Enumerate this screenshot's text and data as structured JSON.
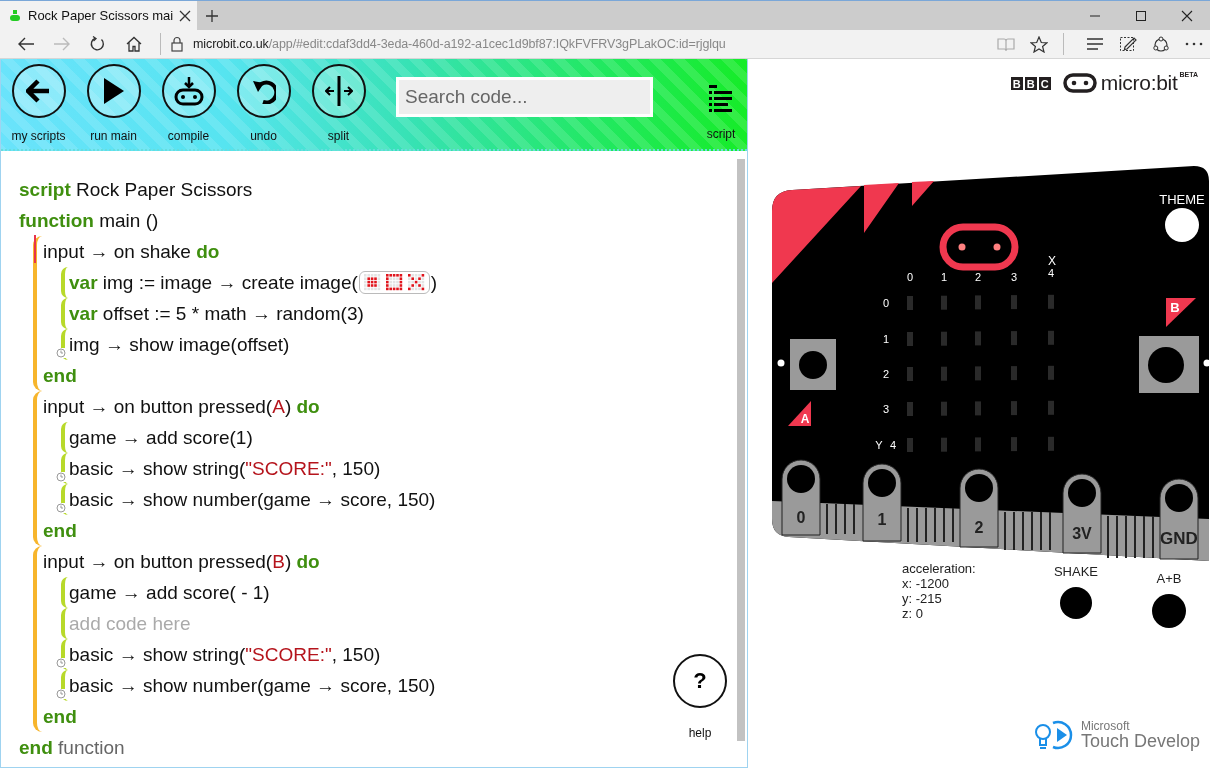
{
  "browser": {
    "tab": {
      "title": "Rock Paper Scissors mai",
      "selected": true
    },
    "back": {
      "disabled": false
    },
    "forward": {
      "disabled": true
    },
    "address": {
      "host": "microbit.co.uk",
      "path": "/app/#edit:cdaf3dd4-3eda-460d-a192-a1cec1d9bf87:IQkFVFRV3gPLakOC:id=rjglqu"
    }
  },
  "toolbar": {
    "buttons": [
      {
        "kind": "back",
        "label": "my scripts"
      },
      {
        "kind": "run",
        "label": "run main"
      },
      {
        "kind": "compile",
        "label": "compile"
      },
      {
        "kind": "undo",
        "label": "undo"
      },
      {
        "kind": "split",
        "label": "split"
      }
    ],
    "search": {
      "placeholder": "Search code..."
    },
    "script_button": {
      "label": "script"
    }
  },
  "code": {
    "title": [
      {
        "kind": "keyword",
        "text": "script"
      },
      {
        "kind": "plain",
        "text": " Rock Paper Scissors"
      }
    ],
    "function": [
      {
        "kind": "keyword",
        "text": "function"
      },
      {
        "kind": "plain",
        "text": " main ()"
      }
    ],
    "blocks": [
      {
        "selected": true,
        "head": [
          {
            "kind": "plain",
            "text": "input → on shake "
          },
          {
            "kind": "keyword",
            "text": "do"
          }
        ],
        "statements": [
          {
            "timer": false,
            "segments": [
              {
                "kind": "keyword",
                "text": "var"
              },
              {
                "kind": "plain",
                "text": " img := image → create image("
              },
              {
                "kind": "image"
              },
              {
                "kind": "plain",
                "text": ")"
              }
            ]
          },
          {
            "timer": false,
            "segments": [
              {
                "kind": "keyword",
                "text": "var"
              },
              {
                "kind": "plain",
                "text": " offset := 5 * math → random(3)"
              }
            ]
          },
          {
            "timer": true,
            "segments": [
              {
                "kind": "plain",
                "text": "img → show image(offset)"
              }
            ]
          }
        ],
        "end": "end"
      },
      {
        "selected": false,
        "head": [
          {
            "kind": "plain",
            "text": "input → on button pressed("
          },
          {
            "kind": "literal",
            "text": "A"
          },
          {
            "kind": "plain",
            "text": ") "
          },
          {
            "kind": "keyword",
            "text": "do"
          }
        ],
        "statements": [
          {
            "timer": false,
            "segments": [
              {
                "kind": "plain",
                "text": "game → add score(1)"
              }
            ]
          },
          {
            "timer": true,
            "segments": [
              {
                "kind": "plain",
                "text": "basic → show string("
              },
              {
                "kind": "literal",
                "text": "\"SCORE:\""
              },
              {
                "kind": "plain",
                "text": ", 150)"
              }
            ]
          },
          {
            "timer": true,
            "segments": [
              {
                "kind": "plain",
                "text": "basic → show number(game → score, 150)"
              }
            ]
          }
        ],
        "end": "end"
      },
      {
        "selected": false,
        "head": [
          {
            "kind": "plain",
            "text": "input → on button pressed("
          },
          {
            "kind": "literal",
            "text": "B"
          },
          {
            "kind": "plain",
            "text": ") "
          },
          {
            "kind": "keyword",
            "text": "do"
          }
        ],
        "statements": [
          {
            "timer": false,
            "segments": [
              {
                "kind": "plain",
                "text": "game → add score( - 1)"
              }
            ]
          },
          {
            "timer": false,
            "segments": [
              {
                "kind": "placeholder",
                "text": "add code here"
              }
            ]
          },
          {
            "timer": true,
            "segments": [
              {
                "kind": "plain",
                "text": "basic → show string("
              },
              {
                "kind": "literal",
                "text": "\"SCORE:\""
              },
              {
                "kind": "plain",
                "text": ", 150)"
              }
            ]
          },
          {
            "timer": true,
            "segments": [
              {
                "kind": "plain",
                "text": "basic → show number(game → score, 150)"
              }
            ]
          }
        ],
        "end": "end"
      }
    ],
    "footer": [
      {
        "kind": "keyword",
        "text": "end"
      },
      {
        "kind": "muted",
        "text": " function"
      }
    ]
  },
  "help": {
    "symbol": "?",
    "label": "help"
  },
  "logo": {
    "bbc": [
      "B",
      "B",
      "C"
    ],
    "product": "micro:bit",
    "badge": "BETA"
  },
  "simulator": {
    "theme_label": "THEME",
    "x_axis": "X",
    "y_axis": "Y",
    "column_labels": [
      "0",
      "1",
      "2",
      "3",
      "4"
    ],
    "row_labels": [
      "0",
      "1",
      "2",
      "3",
      "4"
    ],
    "buttons": [
      "A",
      "B"
    ],
    "pins": [
      "0",
      "1",
      "2",
      "3V",
      "GND"
    ],
    "acceleration": [
      "acceleration:",
      "x: -1200",
      "y: -215",
      "z: 0"
    ],
    "shake_label": "SHAKE",
    "combo_label": "A+B"
  },
  "footer_logo": {
    "vendor": "Microsoft",
    "product": "Touch Develop"
  }
}
